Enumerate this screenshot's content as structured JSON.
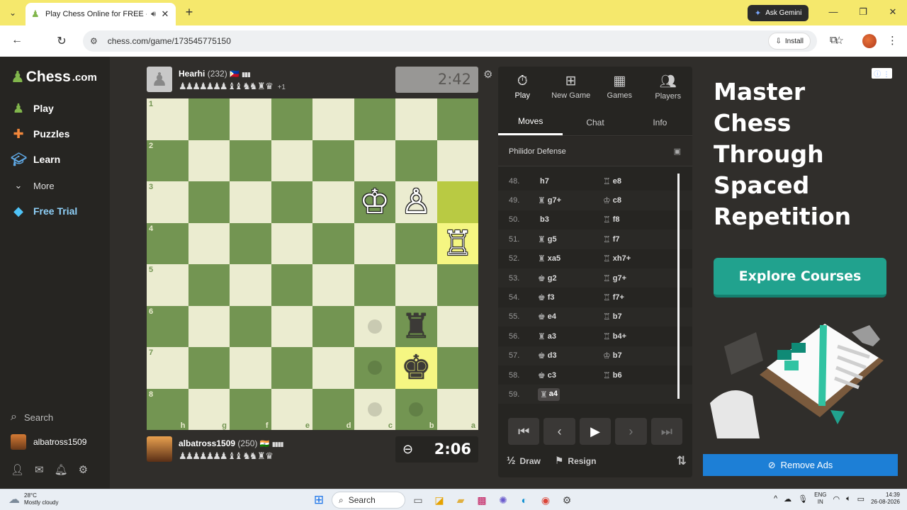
{
  "browser": {
    "tab_title": "Play Chess Online for FREE - 2 Player",
    "new_tab": "+",
    "gemini_label": "Ask Gemini",
    "url": "chess.com/game/173545775150",
    "install_label": "Install"
  },
  "sidebar": {
    "logo_text": "Chess",
    "logo_suffix": ".com",
    "items": [
      {
        "label": "Play",
        "icon": "play-pawn-icon"
      },
      {
        "label": "Puzzles",
        "icon": "puzzle-icon"
      },
      {
        "label": "Learn",
        "icon": "learn-cap-icon"
      },
      {
        "label": "More",
        "icon": "chevron-down-icon"
      },
      {
        "label": "Free Trial",
        "icon": "diamond-icon"
      }
    ],
    "search_label": "Search",
    "username": "albatross1509"
  },
  "top_player": {
    "name": "Hearhi",
    "rating": "(232)",
    "flag": "🇵🇭",
    "captured": "♟♟♟♟♟♟♟ ♝♝ ♞♞ ♜ ♛",
    "material": "+1",
    "clock": "2:42"
  },
  "bottom_player": {
    "name": "albatross1509",
    "rating": "(250)",
    "flag": "🇮🇳",
    "captured": "♟♟♟♟♟♟♟ ♝♝ ♞♞ ♜ ♛",
    "clock": "2:06"
  },
  "board": {
    "ranks": [
      "1",
      "2",
      "3",
      "4",
      "5",
      "6",
      "7",
      "8"
    ],
    "files": [
      "h",
      "g",
      "f",
      "e",
      "d",
      "c",
      "b",
      "a"
    ],
    "pieces": [
      {
        "row": 2,
        "col": 5,
        "glyph": "♔",
        "color": "w"
      },
      {
        "row": 2,
        "col": 6,
        "glyph": "♙",
        "color": "w"
      },
      {
        "row": 3,
        "col": 7,
        "glyph": "♖",
        "color": "w"
      },
      {
        "row": 5,
        "col": 6,
        "glyph": "♜",
        "color": "b"
      },
      {
        "row": 6,
        "col": 6,
        "glyph": "♚",
        "color": "b"
      }
    ],
    "highlights": [
      [
        2,
        7
      ],
      [
        3,
        7
      ],
      [
        6,
        6
      ]
    ],
    "hints": [
      [
        5,
        5
      ],
      [
        6,
        5
      ],
      [
        7,
        5
      ],
      [
        7,
        6
      ]
    ],
    "colors": {
      "light": "#ebecd0",
      "dark": "#739552",
      "highlight_light": "#f5f682",
      "highlight_dark": "#b9ca43"
    }
  },
  "panel": {
    "tabs": [
      {
        "label": "Play",
        "icon": "stopwatch-icon"
      },
      {
        "label": "New Game",
        "icon": "plus-icon"
      },
      {
        "label": "Games",
        "icon": "board-icon"
      },
      {
        "label": "Players",
        "icon": "players-icon"
      }
    ],
    "subtabs": [
      "Moves",
      "Chat",
      "Info"
    ],
    "opening": "Philidor Defense",
    "moves": [
      {
        "num": "48.",
        "w": "h7",
        "wp": "",
        "b": "e8",
        "bp": "♖"
      },
      {
        "num": "49.",
        "w": "g7+",
        "wp": "♜",
        "b": "c8",
        "bp": "♔"
      },
      {
        "num": "50.",
        "w": "b3",
        "wp": "",
        "b": "f8",
        "bp": "♖"
      },
      {
        "num": "51.",
        "w": "g5",
        "wp": "♜",
        "b": "f7",
        "bp": "♖"
      },
      {
        "num": "52.",
        "w": "xa5",
        "wp": "♜",
        "b": "xh7+",
        "bp": "♖"
      },
      {
        "num": "53.",
        "w": "g2",
        "wp": "♚",
        "b": "g7+",
        "bp": "♖"
      },
      {
        "num": "54.",
        "w": "f3",
        "wp": "♚",
        "b": "f7+",
        "bp": "♖"
      },
      {
        "num": "55.",
        "w": "e4",
        "wp": "♚",
        "b": "b7",
        "bp": "♖"
      },
      {
        "num": "56.",
        "w": "a3",
        "wp": "♜",
        "b": "b4+",
        "bp": "♖"
      },
      {
        "num": "57.",
        "w": "d3",
        "wp": "♚",
        "b": "b7",
        "bp": "♔"
      },
      {
        "num": "58.",
        "w": "c3",
        "wp": "♚",
        "b": "b6",
        "bp": "♖"
      },
      {
        "num": "59.",
        "w": "a4",
        "wp": "♜",
        "b": "",
        "bp": ""
      }
    ],
    "controls": [
      "⏮",
      "‹",
      "▶",
      "›",
      "⏭"
    ],
    "draw_label": "Draw",
    "draw_icon_text": "½",
    "resign_label": "Resign"
  },
  "ad": {
    "headline": "Master Chess Through Spaced Repetition",
    "cta": "Explore Courses",
    "remove_ads": "Remove Ads",
    "colors": {
      "cta": "#21a28e",
      "remove": "#1d7fd6"
    }
  },
  "taskbar": {
    "temp": "28°C",
    "weather": "Mostly cloudy",
    "search_label": "Search",
    "lang_1": "ENG",
    "lang_2": "IN",
    "time": "14:39",
    "date": "26-08-2026"
  }
}
